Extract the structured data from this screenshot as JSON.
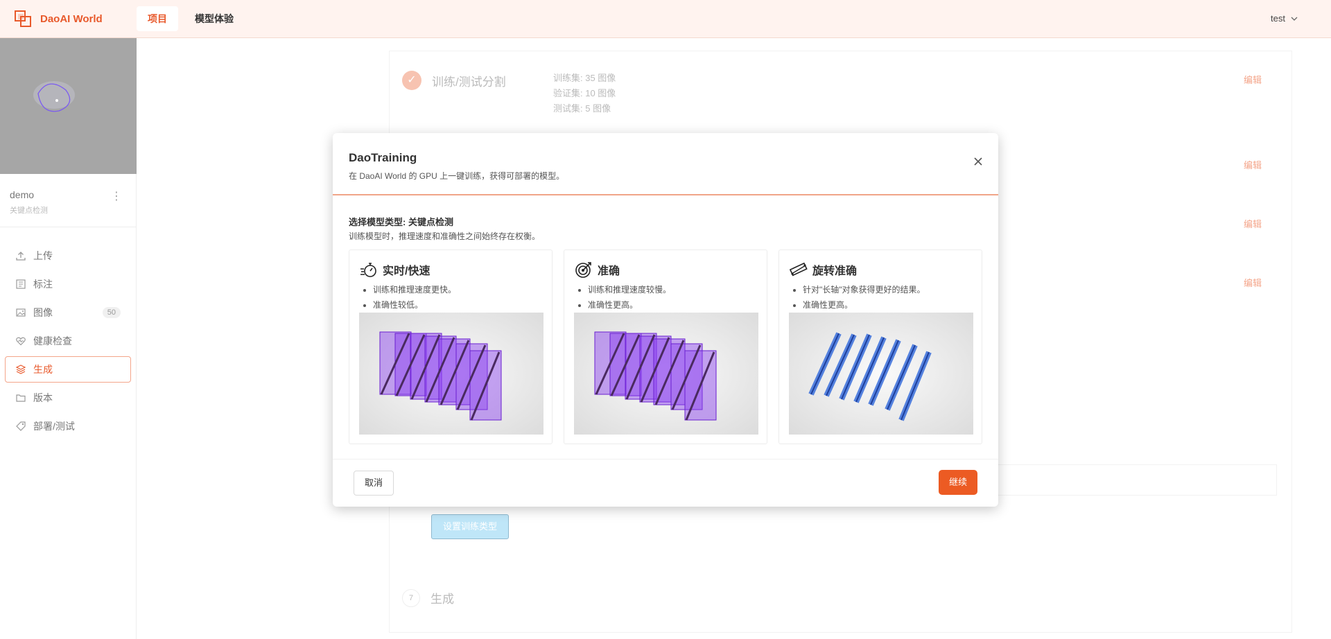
{
  "app": {
    "brand": "DaoAI World",
    "user": "test"
  },
  "nav": {
    "items": [
      "项目",
      "模型体验"
    ]
  },
  "sidebar": {
    "project_name": "demo",
    "project_type": "关键点检测",
    "menu": [
      {
        "label": "上传",
        "icon": "upload-icon"
      },
      {
        "label": "标注",
        "icon": "annotate-icon"
      },
      {
        "label": "图像",
        "icon": "image-icon",
        "badge": "50"
      },
      {
        "label": "健康检查",
        "icon": "heart-icon"
      },
      {
        "label": "生成",
        "icon": "layers-icon",
        "active": true
      },
      {
        "label": "版本",
        "icon": "folder-icon"
      },
      {
        "label": "部署/测试",
        "icon": "tag-icon"
      }
    ]
  },
  "background": {
    "split_title": "训练/测试分割",
    "split_info": [
      "训练集: 35 图像",
      "验证集: 10 图像",
      "测试集: 5 图像"
    ],
    "edit_label": "编辑",
    "set_type_button": "设置训练类型",
    "step7_number": "7",
    "step7_title": "生成"
  },
  "modal": {
    "title": "DaoTraining",
    "subtitle": "在 DaoAI World 的 GPU 上一键训练，获得可部署的模型。",
    "select_title": "选择模型类型: 关键点检测",
    "select_sub": "训练模型时，推理速度和准确性之间始终存在权衡。",
    "options": [
      {
        "name": "实时/快速",
        "icon": "stopwatch-icon",
        "bullets": [
          "训练和推理速度更快。",
          "准确性较低。"
        ]
      },
      {
        "name": "准确",
        "icon": "target-icon",
        "bullets": [
          "训练和推理速度较慢。",
          "准确性更高。"
        ]
      },
      {
        "name": "旋转准确",
        "icon": "rotate-box-icon",
        "bullets": [
          "针对\"长轴\"对象获得更好的结果。",
          "准确性更高。"
        ]
      }
    ],
    "cancel": "取消",
    "continue": "继续"
  },
  "colors": {
    "accent": "#ec5b23",
    "purple": "#8a3ff0",
    "blue": "#3a6fdc"
  }
}
